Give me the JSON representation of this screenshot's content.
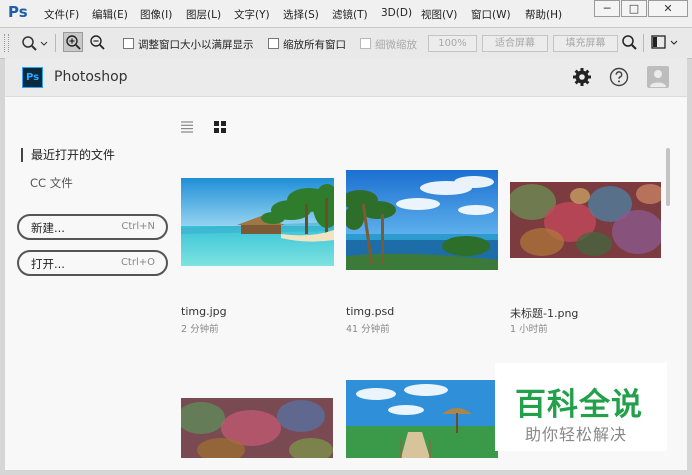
{
  "app_logo": "Ps",
  "menu": [
    "文件(F)",
    "编辑(E)",
    "图像(I)",
    "图层(L)",
    "文字(Y)",
    "选择(S)",
    "滤镜(T)",
    "3D(D)",
    "视图(V)",
    "窗口(W)",
    "帮助(H)"
  ],
  "window_controls": {
    "minimize": "─",
    "maximize": "□",
    "close": "✕"
  },
  "options": {
    "resize_windows": "调整窗口大小以满屏显示",
    "zoom_all": "缩放所有窗口",
    "scrubby_zoom": "细微缩放",
    "zoom_percent": "100%",
    "fit_screen": "适合屏幕",
    "fill_screen": "填充屏幕"
  },
  "header": {
    "badge": "Ps",
    "app_name": "Photoshop"
  },
  "sidebar": {
    "heading": "最近打开的文件",
    "link": "CC 文件",
    "new_label": "新建...",
    "new_shortcut": "Ctrl+N",
    "open_label": "打开...",
    "open_shortcut": "Ctrl+O"
  },
  "files": [
    {
      "name": "timg.jpg",
      "time": "2 分钟前"
    },
    {
      "name": "timg.psd",
      "time": "41 分钟前"
    },
    {
      "name": "未标题-1.png",
      "time": "1 小时前"
    }
  ],
  "watermark": {
    "title": "百科全说",
    "subtitle": "助你轻松解决"
  },
  "colors": {
    "ps_blue": "#31a8ff",
    "watermark_green": "#22a04a"
  }
}
